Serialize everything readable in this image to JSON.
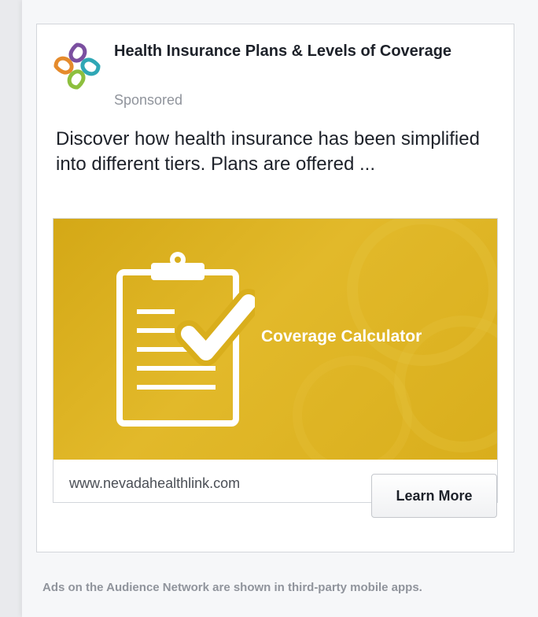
{
  "ad": {
    "title": "Health Insurance Plans & Levels of Coverage",
    "sponsored": "Sponsored",
    "body": "Discover how health insurance has been simplified into different tiers. Plans are offered ...",
    "banner_text": "Coverage Calculator",
    "link_url": "www.nevadahealthlink.com",
    "cta_label": "Learn More"
  },
  "colors": {
    "banner": "#d9ae1c",
    "logo_purple": "#7b4fa0",
    "logo_teal": "#2fa7b5",
    "logo_green": "#8dbf3e",
    "logo_orange": "#e58b2c"
  },
  "footnote": "Ads on the Audience Network are shown in third-party mobile apps."
}
